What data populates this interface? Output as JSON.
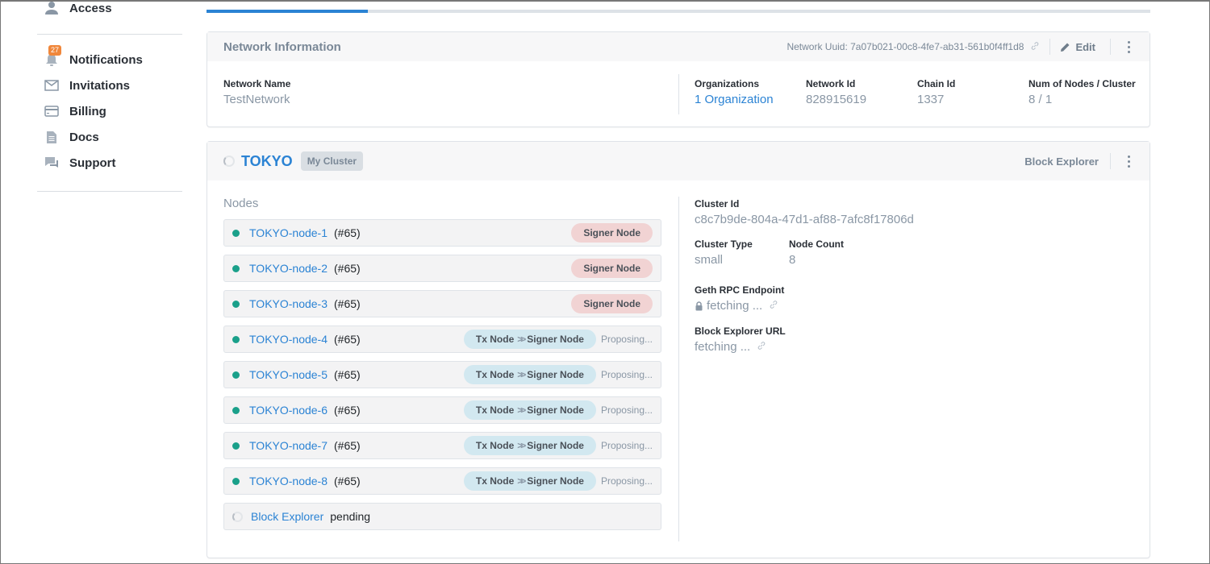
{
  "sidebar": {
    "access": {
      "label": "Access",
      "icon": "user-icon"
    },
    "items": [
      {
        "label": "Notifications",
        "icon": "bell-icon",
        "badge": "27"
      },
      {
        "label": "Invitations",
        "icon": "envelope-icon"
      },
      {
        "label": "Billing",
        "icon": "credit-card-icon"
      },
      {
        "label": "Docs",
        "icon": "document-icon"
      },
      {
        "label": "Support",
        "icon": "chat-icon"
      }
    ]
  },
  "tabs_progress": {
    "active_fraction": 0.171
  },
  "network": {
    "title": "Network Information",
    "uuid_label": "Network Uuid: 7a07b021-00c8-4fe7-ab31-561b0f4ff1d8",
    "edit_label": "Edit",
    "fields": {
      "network_name": {
        "label": "Network Name",
        "value": "TestNetwork"
      },
      "organizations": {
        "label": "Organizations",
        "value": "1 Organization"
      },
      "network_id": {
        "label": "Network Id",
        "value": "828915619"
      },
      "chain_id": {
        "label": "Chain Id",
        "value": "1337"
      },
      "nodes_cluster": {
        "label": "Num of Nodes / Cluster",
        "value": "8 / 1"
      }
    }
  },
  "cluster": {
    "name": "TOKYO",
    "badge": "My Cluster",
    "block_explorer_label": "Block Explorer",
    "nodes_title": "Nodes",
    "nodes": [
      {
        "name": "TOKYO-node-1",
        "num": "(#65)",
        "role": "signer",
        "role_label": "Signer Node"
      },
      {
        "name": "TOKYO-node-2",
        "num": "(#65)",
        "role": "signer",
        "role_label": "Signer Node"
      },
      {
        "name": "TOKYO-node-3",
        "num": "(#65)",
        "role": "signer",
        "role_label": "Signer Node"
      },
      {
        "name": "TOKYO-node-4",
        "num": "(#65)",
        "role": "tx",
        "from_label": "Tx Node",
        "to_label": "Signer Node",
        "status": "Proposing..."
      },
      {
        "name": "TOKYO-node-5",
        "num": "(#65)",
        "role": "tx",
        "from_label": "Tx Node",
        "to_label": "Signer Node",
        "status": "Proposing..."
      },
      {
        "name": "TOKYO-node-6",
        "num": "(#65)",
        "role": "tx",
        "from_label": "Tx Node",
        "to_label": "Signer Node",
        "status": "Proposing..."
      },
      {
        "name": "TOKYO-node-7",
        "num": "(#65)",
        "role": "tx",
        "from_label": "Tx Node",
        "to_label": "Signer Node",
        "status": "Proposing..."
      },
      {
        "name": "TOKYO-node-8",
        "num": "(#65)",
        "role": "tx",
        "from_label": "Tx Node",
        "to_label": "Signer Node",
        "status": "Proposing..."
      }
    ],
    "block_explorer_row": {
      "name": "Block Explorer",
      "status": "pending"
    },
    "info": {
      "cluster_id": {
        "label": "Cluster Id",
        "value": "c8c7b9de-804a-47d1-af88-7afc8f17806d"
      },
      "cluster_type": {
        "label": "Cluster Type",
        "value": "small"
      },
      "node_count": {
        "label": "Node Count",
        "value": "8"
      },
      "geth_rpc": {
        "label": "Geth RPC Endpoint",
        "value": "fetching ..."
      },
      "block_explorer_url": {
        "label": "Block Explorer URL",
        "value": "fetching ..."
      }
    }
  },
  "colors": {
    "accent": "#2b83d4",
    "node_ok": "#1aa08a",
    "badge": "#f0873b",
    "signer_pill": "#f1d3d3",
    "tx_pill": "#d2e8f0"
  }
}
